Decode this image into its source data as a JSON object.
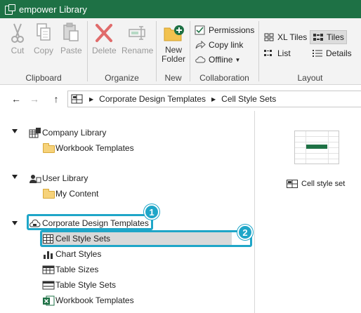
{
  "window": {
    "title": "empower Library"
  },
  "ribbon": {
    "clipboard": {
      "label": "Clipboard",
      "cut": "Cut",
      "copy": "Copy",
      "paste": "Paste"
    },
    "organize": {
      "label": "Organize",
      "delete": "Delete",
      "rename": "Rename"
    },
    "new": {
      "label": "New",
      "new_folder_line1": "New",
      "new_folder_line2": "Folder"
    },
    "collaboration": {
      "label": "Collaboration",
      "permissions": "Permissions",
      "copy_link": "Copy link",
      "offline": "Offline"
    },
    "layout": {
      "label": "Layout",
      "xl_tiles": "XL Tiles",
      "tiles": "Tiles",
      "list": "List",
      "details": "Details"
    }
  },
  "nav": {
    "breadcrumbs": [
      "Corporate Design Templates",
      "Cell Style Sets"
    ]
  },
  "tree": {
    "company_library": {
      "label": "Company Library",
      "children": [
        "Workbook Templates"
      ]
    },
    "user_library": {
      "label": "User Library",
      "children": [
        "My Content"
      ]
    },
    "corporate": {
      "label": "Corporate Design Templates",
      "children": [
        "Cell Style Sets",
        "Chart Styles",
        "Table Sizes",
        "Table Style Sets",
        "Workbook Templates"
      ]
    }
  },
  "callouts": [
    "1",
    "2"
  ],
  "content": {
    "items": [
      {
        "label": "Cell style set"
      }
    ]
  },
  "colors": {
    "titlebar": "#1e7145",
    "callout": "#1fa6c8",
    "selection": "#d9d9d9"
  }
}
